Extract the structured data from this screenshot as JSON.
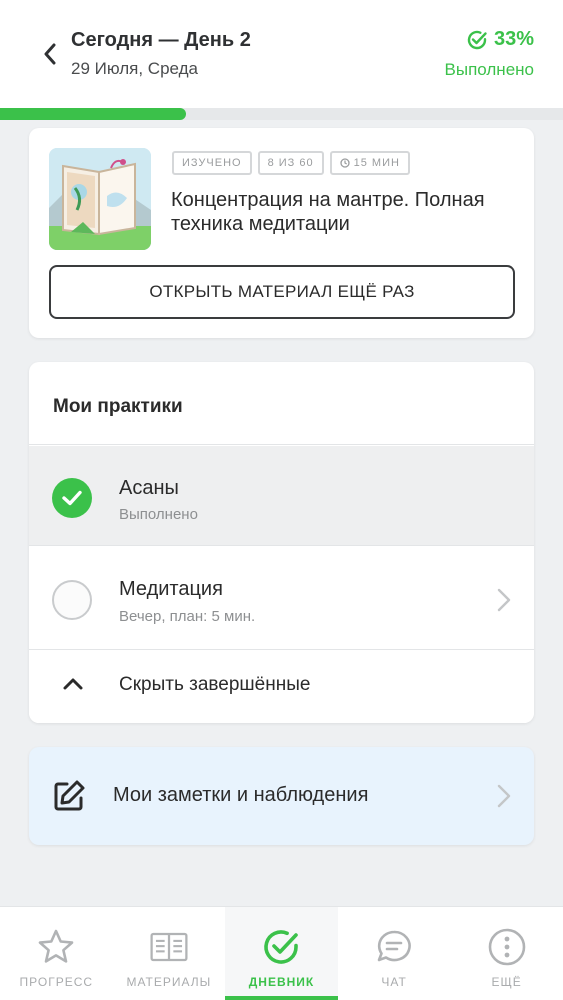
{
  "header": {
    "title": "Сегодня — День 2",
    "date": "29 Июля, Среда",
    "percent": "33%",
    "status": "Выполнено",
    "progress_fraction": 0.33,
    "accent_color": "#3bc14a",
    "back_icon": "chevron-left-icon",
    "status_icon": "check-circle-icon"
  },
  "material": {
    "tags": [
      "ИЗУЧЕНО",
      "8 ИЗ 60",
      "15 МИН"
    ],
    "title": "Концентрация на мантре. Полная техника медитации",
    "open_button": "ОТКРЫТЬ МАТЕРИАЛ ЕЩЁ РАЗ",
    "time_icon": "clock-icon"
  },
  "practices": {
    "title": "Мои практики",
    "items": [
      {
        "title": "Асаны",
        "subtitle": "Выполнено",
        "done": true
      },
      {
        "title": "Медитация",
        "subtitle": "Вечер, план: 5 мин.",
        "done": false
      }
    ],
    "hide_label": "Скрыть завершённые"
  },
  "notes": {
    "label": "Мои заметки и наблюдения",
    "icon": "edit-note-icon"
  },
  "nav": {
    "items": [
      {
        "label": "ПРОГРЕСС",
        "icon": "star-icon"
      },
      {
        "label": "МАТЕРИАЛЫ",
        "icon": "book-icon"
      },
      {
        "label": "ДНЕВНИК",
        "icon": "check-circle-icon",
        "active": true
      },
      {
        "label": "ЧАТ",
        "icon": "chat-bubble-icon"
      },
      {
        "label": "ЕЩЁ",
        "icon": "more-icon"
      }
    ]
  }
}
